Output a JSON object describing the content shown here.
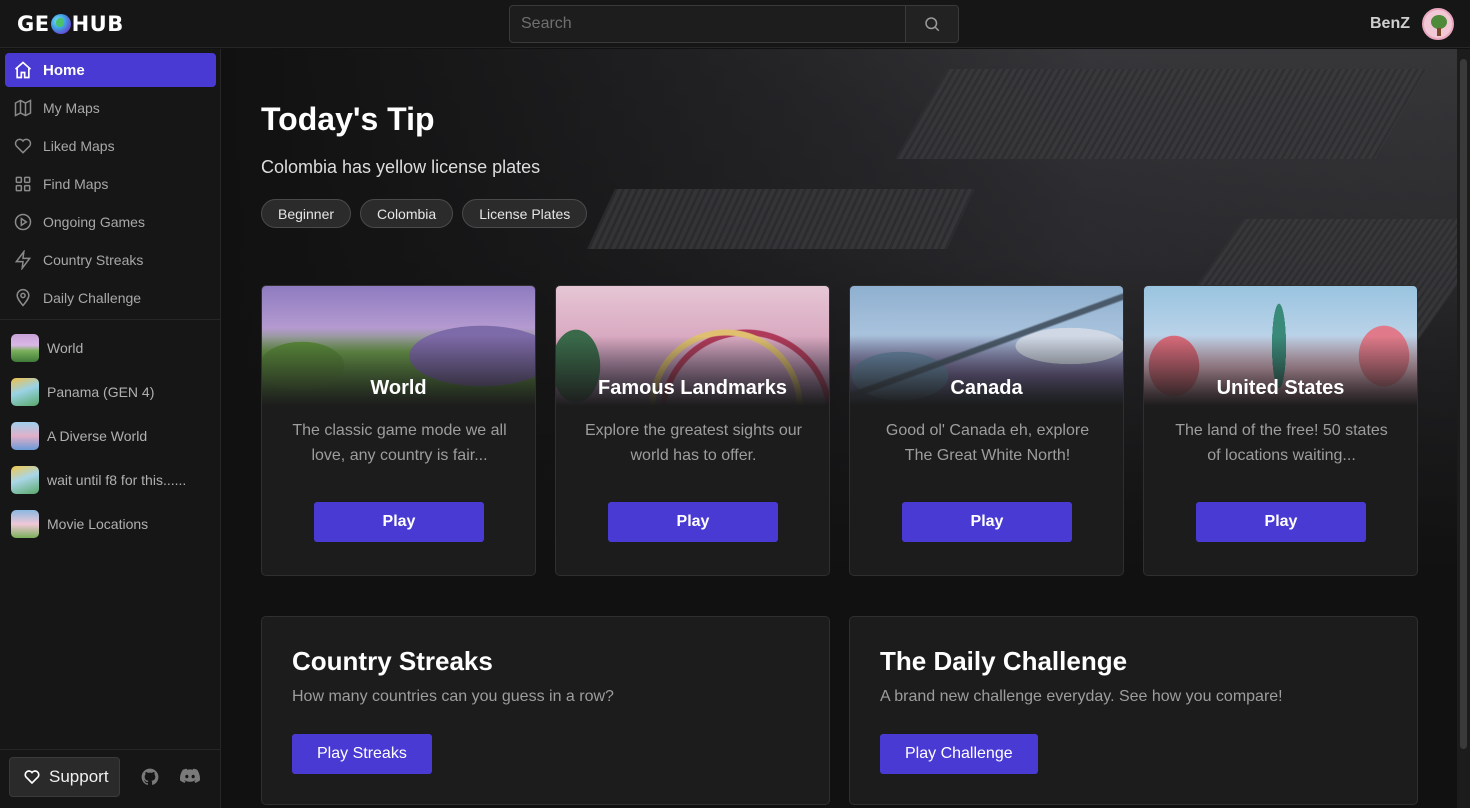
{
  "app": {
    "logo_text_left": "GE",
    "logo_text_right": "HUB"
  },
  "search": {
    "placeholder": "Search"
  },
  "user": {
    "name": "BenZ"
  },
  "sidebar": {
    "nav": [
      {
        "label": "Home",
        "icon": "home-icon",
        "active": true
      },
      {
        "label": "My Maps",
        "icon": "map-icon"
      },
      {
        "label": "Liked Maps",
        "icon": "heart-icon"
      },
      {
        "label": "Find Maps",
        "icon": "grid-icon"
      },
      {
        "label": "Ongoing Games",
        "icon": "play-circle-icon"
      },
      {
        "label": "Country Streaks",
        "icon": "lightning-icon"
      },
      {
        "label": "Daily Challenge",
        "icon": "location-pin-icon"
      }
    ],
    "maps": [
      {
        "label": "World"
      },
      {
        "label": "Panama (GEN 4)"
      },
      {
        "label": "A Diverse World"
      },
      {
        "label": "wait until f8 for this......"
      },
      {
        "label": "Movie Locations"
      }
    ],
    "support_label": "Support"
  },
  "tip": {
    "title": "Today's Tip",
    "text": "Colombia has yellow license plates",
    "tags": [
      "Beginner",
      "Colombia",
      "License Plates"
    ]
  },
  "cards": [
    {
      "title": "World",
      "description": "The classic game mode we all love, any country is fair...",
      "button": "Play"
    },
    {
      "title": "Famous Landmarks",
      "description": "Explore the greatest sights our world has to offer.",
      "button": "Play"
    },
    {
      "title": "Canada",
      "description": "Good ol' Canada eh, explore The Great White North!",
      "button": "Play"
    },
    {
      "title": "United States",
      "description": "The land of the free! 50 states of locations waiting...",
      "button": "Play"
    }
  ],
  "panels": {
    "streaks": {
      "title": "Country Streaks",
      "text": "How many countries can you guess in a row?",
      "button": "Play Streaks"
    },
    "daily": {
      "title": "The Daily Challenge",
      "text": "A brand new challenge everyday. See how you compare!",
      "button": "Play Challenge"
    }
  },
  "colors": {
    "accent": "#4a3ad4",
    "background": "#111111",
    "surface": "#1c1c1c"
  }
}
